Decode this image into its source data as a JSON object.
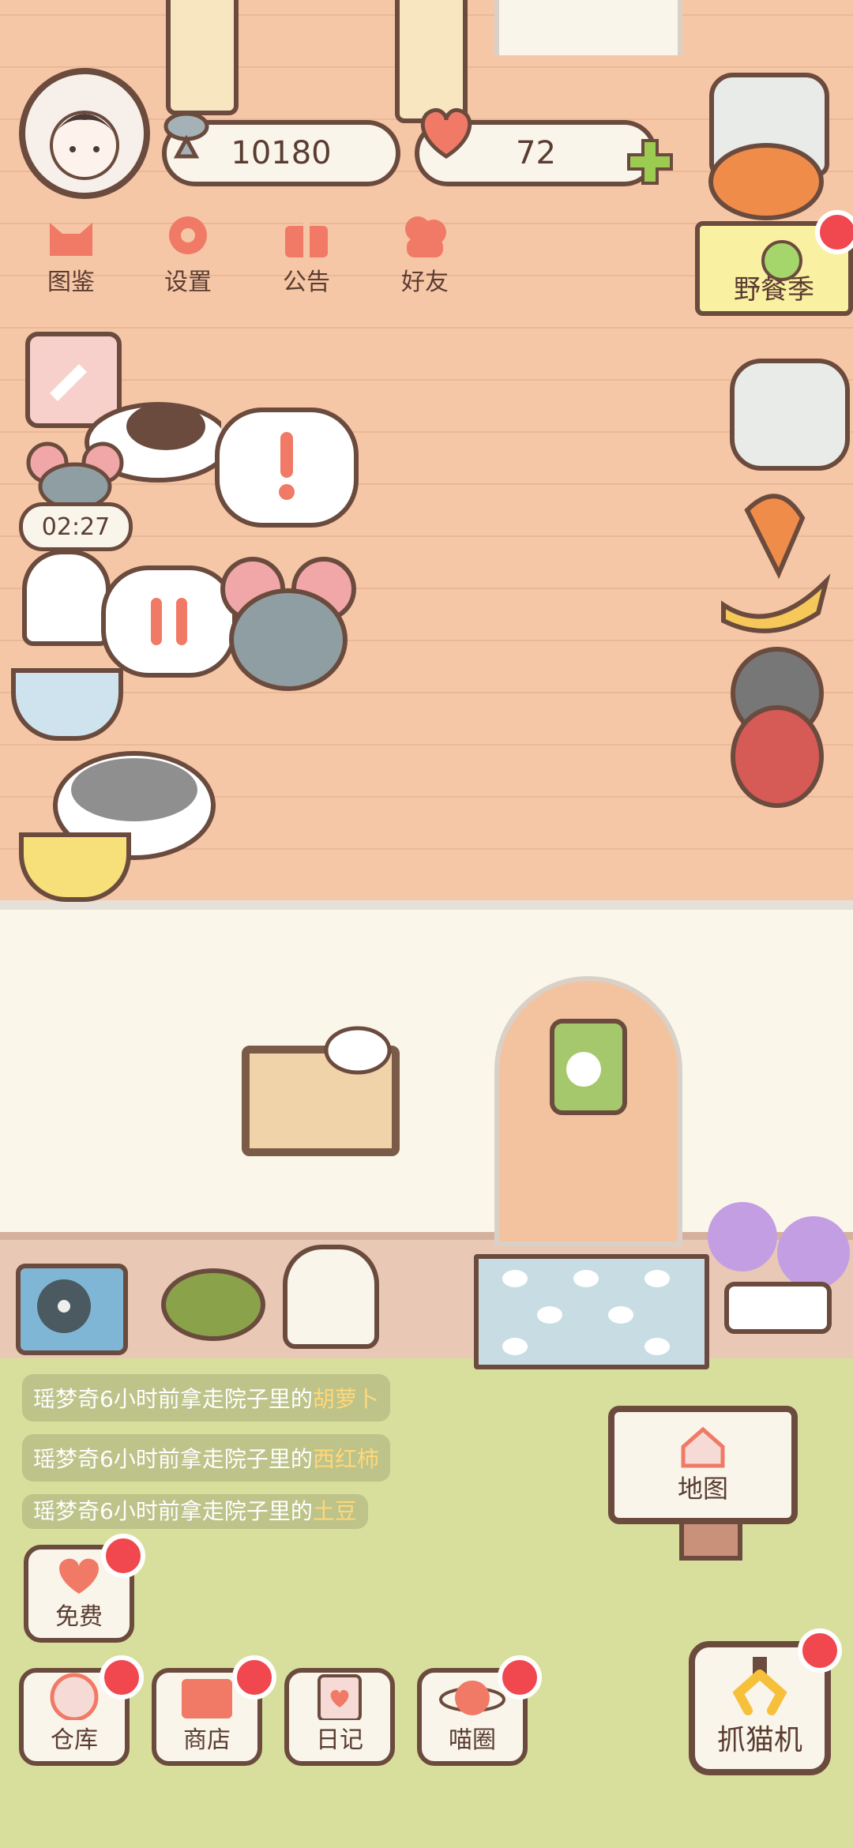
{
  "top_bar": {
    "coins": "10180",
    "hearts": "72",
    "plus_icon": "plus-icon"
  },
  "menu": {
    "items": [
      {
        "label": "图鉴",
        "icon": "cat-face-icon"
      },
      {
        "label": "设置",
        "icon": "gear-icon"
      },
      {
        "label": "公告",
        "icon": "gift-icon"
      },
      {
        "label": "好友",
        "icon": "friends-icon"
      }
    ]
  },
  "timer": "02:27",
  "season": {
    "label": "野餐季"
  },
  "feed": [
    {
      "prefix": "瑶梦奇6小时前拿走院子里的",
      "item": "胡萝卜"
    },
    {
      "prefix": "瑶梦奇6小时前拿走院子里的",
      "item": "西红柿"
    },
    {
      "prefix": "瑶梦奇6小时前拿走院子里的",
      "item": "土豆"
    }
  ],
  "map_button": {
    "label": "地图",
    "icon": "house-icon"
  },
  "free_button": {
    "label": "免费",
    "icon": "heart-icon"
  },
  "bottom_bar": [
    {
      "label": "仓库",
      "icon": "storage-icon"
    },
    {
      "label": "商店",
      "icon": "shop-icon"
    },
    {
      "label": "日记",
      "icon": "diary-icon"
    },
    {
      "label": "喵圈",
      "icon": "cat-planet-icon"
    }
  ],
  "claw_machine": {
    "label": "抓猫机",
    "icon": "claw-icon"
  },
  "colors": {
    "accent": "#f07a66",
    "outline": "#6b4b3e",
    "badge_red": "#f0484e",
    "highlight_text": "#ffd879"
  }
}
